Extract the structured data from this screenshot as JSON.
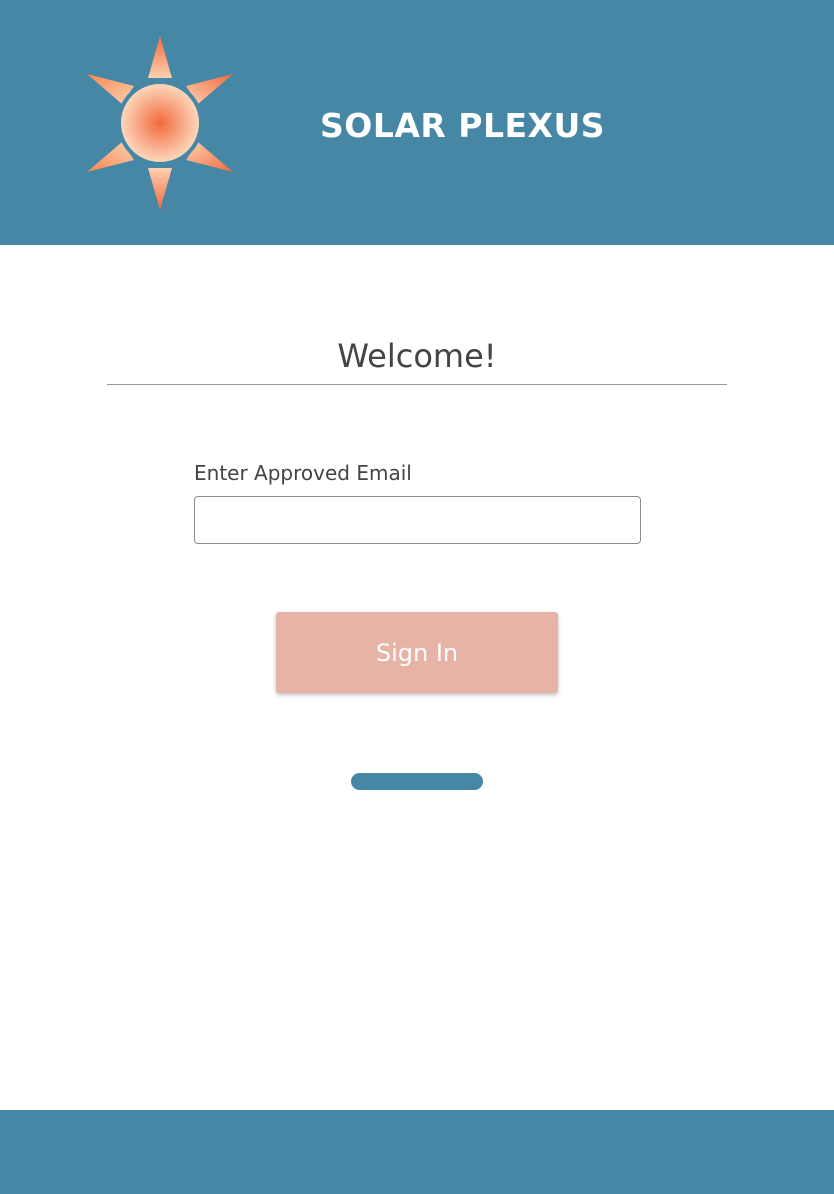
{
  "header": {
    "logo_icon": "sun-icon",
    "brand_title": "SOLAR PLEXUS",
    "background_color": "#4587a5"
  },
  "login": {
    "heading": "Welcome!",
    "email_label": "Enter Approved Email",
    "email_value": "",
    "email_placeholder": "",
    "sign_in_label": "Sign In",
    "sign_in_color": "#e7b3a6"
  },
  "colors": {
    "accent_blue": "#4587a5",
    "sun_orange": "#f26a3d",
    "sun_light": "#fbd3b4"
  }
}
